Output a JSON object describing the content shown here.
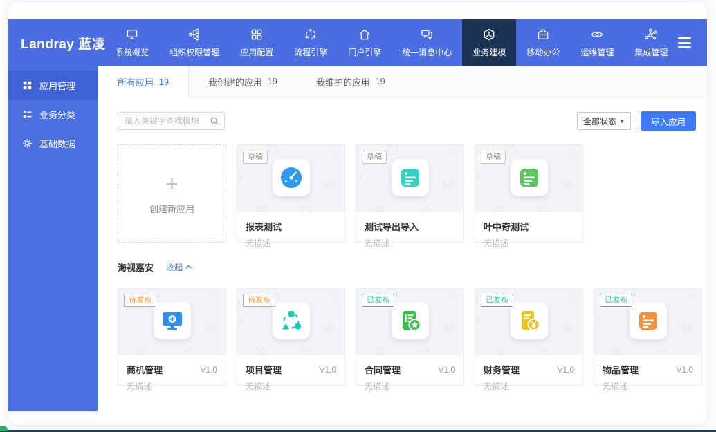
{
  "colors": {
    "header_blue": "#4a6de2",
    "sidebar_blue": "#4a6fde",
    "active_nav_navy": "#1d3356",
    "accent_blue": "#3e7bfa",
    "draft_gray": "#8a8a8a",
    "pending_orange": "#ff9b43",
    "published_green": "#34c596"
  },
  "brand": {
    "logo_text": "Landray 蓝凌"
  },
  "top_nav": {
    "items": [
      {
        "label": "系统概览",
        "icon": "monitor-icon",
        "active": false
      },
      {
        "label": "组织权限管理",
        "icon": "org-chart-icon",
        "active": false
      },
      {
        "label": "应用配置",
        "icon": "app-grid-icon",
        "active": false
      },
      {
        "label": "流程引擎",
        "icon": "cycle-icon",
        "active": false
      },
      {
        "label": "门户引擎",
        "icon": "home-icon",
        "active": false
      },
      {
        "label": "统一消息中心",
        "icon": "chat-icon",
        "active": false
      },
      {
        "label": "业务建模",
        "icon": "cube-icon",
        "active": true
      },
      {
        "label": "移动办公",
        "icon": "briefcase-icon",
        "active": false
      },
      {
        "label": "运维管理",
        "icon": "eye-icon",
        "active": false
      },
      {
        "label": "集成管理",
        "icon": "network-icon",
        "active": false
      }
    ]
  },
  "sidebar": {
    "items": [
      {
        "label": "应用管理",
        "icon": "apps-grid-icon",
        "active": true
      },
      {
        "label": "业务分类",
        "icon": "category-list-icon",
        "active": false
      },
      {
        "label": "基础数据",
        "icon": "gear-icon",
        "active": false
      }
    ]
  },
  "tabs": [
    {
      "label": "所有应用",
      "count": "19",
      "active": true
    },
    {
      "label": "我创建的应用",
      "count": "19",
      "active": false
    },
    {
      "label": "我维护的应用",
      "count": "19",
      "active": false
    }
  ],
  "toolbar": {
    "search_placeholder": "输入关键字查找模块",
    "status_filter": "全部状态",
    "import_button": "导入应用"
  },
  "create_card": {
    "label": "创建新应用"
  },
  "draft_apps": [
    {
      "badge": "草稿",
      "status": "draft",
      "title": "报表测试",
      "desc": "无描述",
      "icon": "gauge-icon",
      "icon_color": "#2f9bf0"
    },
    {
      "badge": "草稿",
      "status": "draft",
      "title": "测试导出导入",
      "desc": "无描述",
      "icon": "doc-lines-icon",
      "icon_color": "#2ed3c5"
    },
    {
      "badge": "草稿",
      "status": "draft",
      "title": "叶中奇测试",
      "desc": "无描述",
      "icon": "doc-lines-icon",
      "icon_color": "#5dc663"
    }
  ],
  "section": {
    "title": "海视嘉安",
    "collapse_label": "收起",
    "apps": [
      {
        "badge": "待发布",
        "status": "pending",
        "title": "商机管理",
        "version": "V1.0",
        "desc": "无描述",
        "icon": "monitor-plus-icon",
        "icon_color": "#2f8ef0"
      },
      {
        "badge": "待发布",
        "status": "pending",
        "title": "项目管理",
        "version": "V1.0",
        "desc": "无描述",
        "icon": "nodes-icon",
        "icon_color": "#1ec9b4"
      },
      {
        "badge": "已发布",
        "status": "published",
        "title": "合同管理",
        "version": "V1.0",
        "desc": "无描述",
        "icon": "doc-star-icon",
        "icon_color": "#3fbb4f"
      },
      {
        "badge": "已发布",
        "status": "published",
        "title": "财务管理",
        "version": "V1.0",
        "desc": "无描述",
        "icon": "doc-yen-icon",
        "icon_color": "#e9c326"
      },
      {
        "badge": "已发布",
        "status": "published",
        "title": "物品管理",
        "version": "V1.0",
        "desc": "无描述",
        "icon": "doc-lines-icon",
        "icon_color": "#f09043"
      }
    ]
  }
}
